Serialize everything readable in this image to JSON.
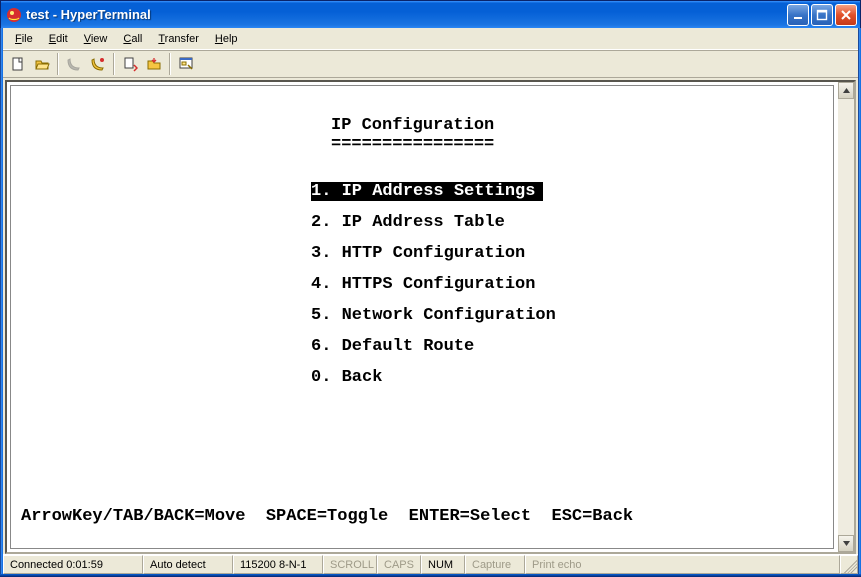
{
  "title": "test - HyperTerminal",
  "menus": {
    "file": {
      "label": "File",
      "accel": "F"
    },
    "edit": {
      "label": "Edit",
      "accel": "E"
    },
    "view": {
      "label": "View",
      "accel": "V"
    },
    "call": {
      "label": "Call",
      "accel": "C"
    },
    "transfer": {
      "label": "Transfer",
      "accel": "T"
    },
    "help": {
      "label": "Help",
      "accel": "H"
    }
  },
  "toolbar": {
    "new": "new-icon",
    "open": "open-icon",
    "call": "call-icon",
    "hangup": "hangup-icon",
    "send": "send-icon",
    "receive": "receive-icon",
    "properties": "properties-icon"
  },
  "terminal": {
    "title": "IP Configuration",
    "underline": "================",
    "items": [
      {
        "num": "1.",
        "label": "IP Address Settings",
        "selected": true
      },
      {
        "num": "2.",
        "label": "IP Address Table",
        "selected": false
      },
      {
        "num": "3.",
        "label": "HTTP Configuration",
        "selected": false
      },
      {
        "num": "4.",
        "label": "HTTPS Configuration",
        "selected": false
      },
      {
        "num": "5.",
        "label": "Network Configuration",
        "selected": false
      },
      {
        "num": "6.",
        "label": "Default Route",
        "selected": false
      },
      {
        "num": "0.",
        "label": "Back",
        "selected": false
      }
    ],
    "help": "ArrowKey/TAB/BACK=Move  SPACE=Toggle  ENTER=Select  ESC=Back"
  },
  "status": {
    "connected": "Connected 0:01:59",
    "autodetect": "Auto detect",
    "port": "115200 8-N-1",
    "scroll": "SCROLL",
    "caps": "CAPS",
    "num": "NUM",
    "capture": "Capture",
    "printecho": "Print echo"
  }
}
